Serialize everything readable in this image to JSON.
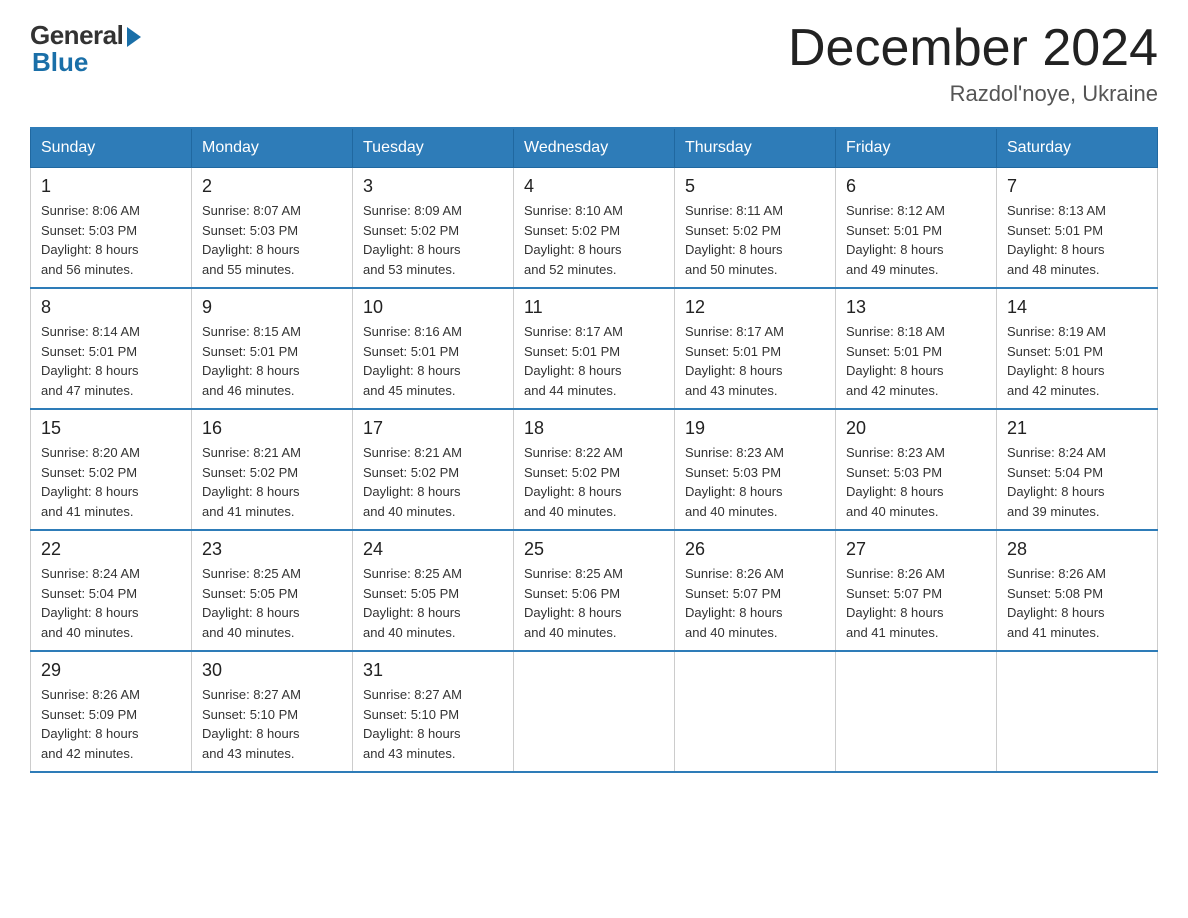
{
  "logo": {
    "general": "General",
    "blue": "Blue"
  },
  "title": "December 2024",
  "subtitle": "Razdol'noye, Ukraine",
  "days_of_week": [
    "Sunday",
    "Monday",
    "Tuesday",
    "Wednesday",
    "Thursday",
    "Friday",
    "Saturday"
  ],
  "weeks": [
    [
      {
        "num": "1",
        "sunrise": "8:06 AM",
        "sunset": "5:03 PM",
        "daylight": "8 hours and 56 minutes."
      },
      {
        "num": "2",
        "sunrise": "8:07 AM",
        "sunset": "5:03 PM",
        "daylight": "8 hours and 55 minutes."
      },
      {
        "num": "3",
        "sunrise": "8:09 AM",
        "sunset": "5:02 PM",
        "daylight": "8 hours and 53 minutes."
      },
      {
        "num": "4",
        "sunrise": "8:10 AM",
        "sunset": "5:02 PM",
        "daylight": "8 hours and 52 minutes."
      },
      {
        "num": "5",
        "sunrise": "8:11 AM",
        "sunset": "5:02 PM",
        "daylight": "8 hours and 50 minutes."
      },
      {
        "num": "6",
        "sunrise": "8:12 AM",
        "sunset": "5:01 PM",
        "daylight": "8 hours and 49 minutes."
      },
      {
        "num": "7",
        "sunrise": "8:13 AM",
        "sunset": "5:01 PM",
        "daylight": "8 hours and 48 minutes."
      }
    ],
    [
      {
        "num": "8",
        "sunrise": "8:14 AM",
        "sunset": "5:01 PM",
        "daylight": "8 hours and 47 minutes."
      },
      {
        "num": "9",
        "sunrise": "8:15 AM",
        "sunset": "5:01 PM",
        "daylight": "8 hours and 46 minutes."
      },
      {
        "num": "10",
        "sunrise": "8:16 AM",
        "sunset": "5:01 PM",
        "daylight": "8 hours and 45 minutes."
      },
      {
        "num": "11",
        "sunrise": "8:17 AM",
        "sunset": "5:01 PM",
        "daylight": "8 hours and 44 minutes."
      },
      {
        "num": "12",
        "sunrise": "8:17 AM",
        "sunset": "5:01 PM",
        "daylight": "8 hours and 43 minutes."
      },
      {
        "num": "13",
        "sunrise": "8:18 AM",
        "sunset": "5:01 PM",
        "daylight": "8 hours and 42 minutes."
      },
      {
        "num": "14",
        "sunrise": "8:19 AM",
        "sunset": "5:01 PM",
        "daylight": "8 hours and 42 minutes."
      }
    ],
    [
      {
        "num": "15",
        "sunrise": "8:20 AM",
        "sunset": "5:02 PM",
        "daylight": "8 hours and 41 minutes."
      },
      {
        "num": "16",
        "sunrise": "8:21 AM",
        "sunset": "5:02 PM",
        "daylight": "8 hours and 41 minutes."
      },
      {
        "num": "17",
        "sunrise": "8:21 AM",
        "sunset": "5:02 PM",
        "daylight": "8 hours and 40 minutes."
      },
      {
        "num": "18",
        "sunrise": "8:22 AM",
        "sunset": "5:02 PM",
        "daylight": "8 hours and 40 minutes."
      },
      {
        "num": "19",
        "sunrise": "8:23 AM",
        "sunset": "5:03 PM",
        "daylight": "8 hours and 40 minutes."
      },
      {
        "num": "20",
        "sunrise": "8:23 AM",
        "sunset": "5:03 PM",
        "daylight": "8 hours and 40 minutes."
      },
      {
        "num": "21",
        "sunrise": "8:24 AM",
        "sunset": "5:04 PM",
        "daylight": "8 hours and 39 minutes."
      }
    ],
    [
      {
        "num": "22",
        "sunrise": "8:24 AM",
        "sunset": "5:04 PM",
        "daylight": "8 hours and 40 minutes."
      },
      {
        "num": "23",
        "sunrise": "8:25 AM",
        "sunset": "5:05 PM",
        "daylight": "8 hours and 40 minutes."
      },
      {
        "num": "24",
        "sunrise": "8:25 AM",
        "sunset": "5:05 PM",
        "daylight": "8 hours and 40 minutes."
      },
      {
        "num": "25",
        "sunrise": "8:25 AM",
        "sunset": "5:06 PM",
        "daylight": "8 hours and 40 minutes."
      },
      {
        "num": "26",
        "sunrise": "8:26 AM",
        "sunset": "5:07 PM",
        "daylight": "8 hours and 40 minutes."
      },
      {
        "num": "27",
        "sunrise": "8:26 AM",
        "sunset": "5:07 PM",
        "daylight": "8 hours and 41 minutes."
      },
      {
        "num": "28",
        "sunrise": "8:26 AM",
        "sunset": "5:08 PM",
        "daylight": "8 hours and 41 minutes."
      }
    ],
    [
      {
        "num": "29",
        "sunrise": "8:26 AM",
        "sunset": "5:09 PM",
        "daylight": "8 hours and 42 minutes."
      },
      {
        "num": "30",
        "sunrise": "8:27 AM",
        "sunset": "5:10 PM",
        "daylight": "8 hours and 43 minutes."
      },
      {
        "num": "31",
        "sunrise": "8:27 AM",
        "sunset": "5:10 PM",
        "daylight": "8 hours and 43 minutes."
      },
      null,
      null,
      null,
      null
    ]
  ],
  "labels": {
    "sunrise": "Sunrise:",
    "sunset": "Sunset:",
    "daylight": "Daylight:"
  }
}
